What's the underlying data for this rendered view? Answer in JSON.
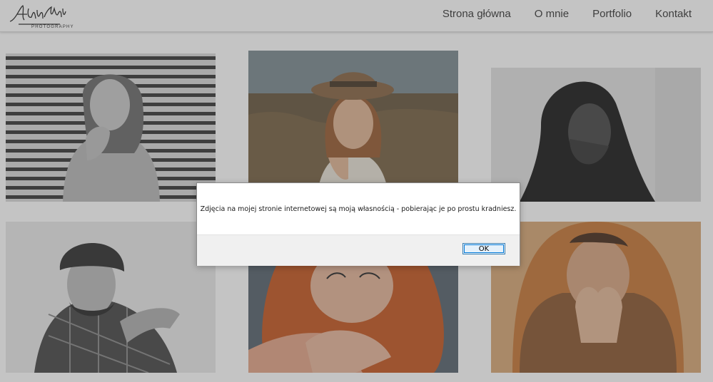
{
  "site": {
    "logo_text": "Adam Novak",
    "logo_sub": "PHOTOGRAPHY"
  },
  "nav": [
    {
      "label": "Strona główna"
    },
    {
      "label": "O mnie"
    },
    {
      "label": "Portfolio"
    },
    {
      "label": "Kontakt"
    }
  ],
  "gallery": [
    {
      "subject": "woman-blinds-bw"
    },
    {
      "subject": "woman-hat-field"
    },
    {
      "subject": "woman-dark-hair-bw"
    },
    {
      "subject": "man-beanie-bw"
    },
    {
      "subject": "woman-red-hair"
    },
    {
      "subject": "man-fur-hood"
    }
  ],
  "dialog": {
    "message": "Zdjęcia na mojej stronie internetowej są moją własnością - pobierając je po prostu kradniesz.",
    "ok_label": "OK"
  },
  "colors": {
    "overlay": "#464646",
    "dialog_button_border": "#3c7fb1"
  }
}
